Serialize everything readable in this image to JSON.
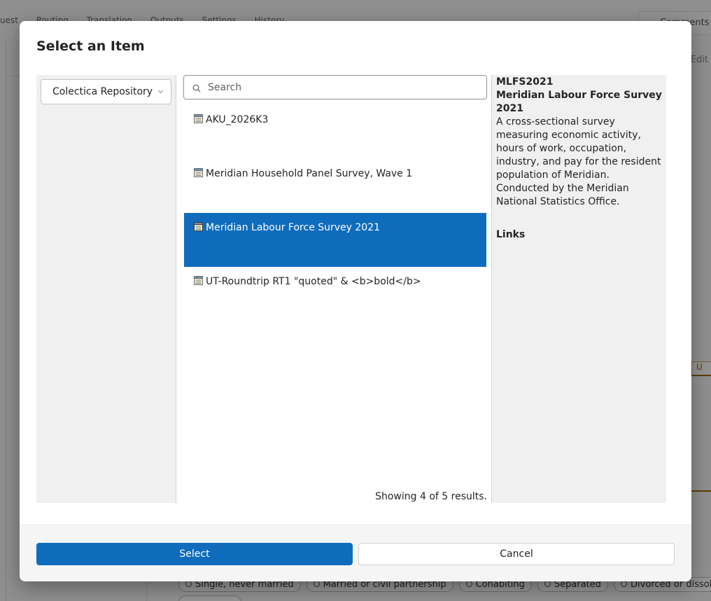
{
  "background": {
    "tabs": [
      "uest",
      "Routing",
      "Translation",
      "Outputs",
      "Settings",
      "History"
    ],
    "comments_label": "Comments",
    "edit_label": "Edit",
    "unlink_label": "U",
    "chips": [
      "Single, never married",
      "Married or civil partnership",
      "Cohabiting",
      "Separated",
      "Divorced or dissolved"
    ]
  },
  "modal": {
    "title": "Select an Item",
    "repository": {
      "selected": "Colectica Repository"
    },
    "search": {
      "placeholder": "Search",
      "value": ""
    },
    "items": [
      {
        "label": "AKU_2026K3",
        "selected": false
      },
      {
        "label": "Meridian Household Panel Survey, Wave 1",
        "selected": false
      },
      {
        "label": "Meridian Labour Force Survey 2021",
        "selected": true
      },
      {
        "label": "UT-Roundtrip RT1 \"quoted\" & <b>bold</b>",
        "selected": false
      }
    ],
    "results_text": "Showing 4 of 5 results.",
    "detail": {
      "id": "MLFS2021",
      "name": "Meridian Labour Force Survey 2021",
      "description": "A cross-sectional survey measuring economic activity, hours of work, occupation, industry, and pay for the resident population of Meridian. Conducted by the Meridian National Statistics Office.",
      "links_heading": "Links"
    },
    "buttons": {
      "select": "Select",
      "cancel": "Cancel"
    }
  },
  "colors": {
    "accent": "#0f6cbd",
    "panel": "#f0f0f0"
  }
}
